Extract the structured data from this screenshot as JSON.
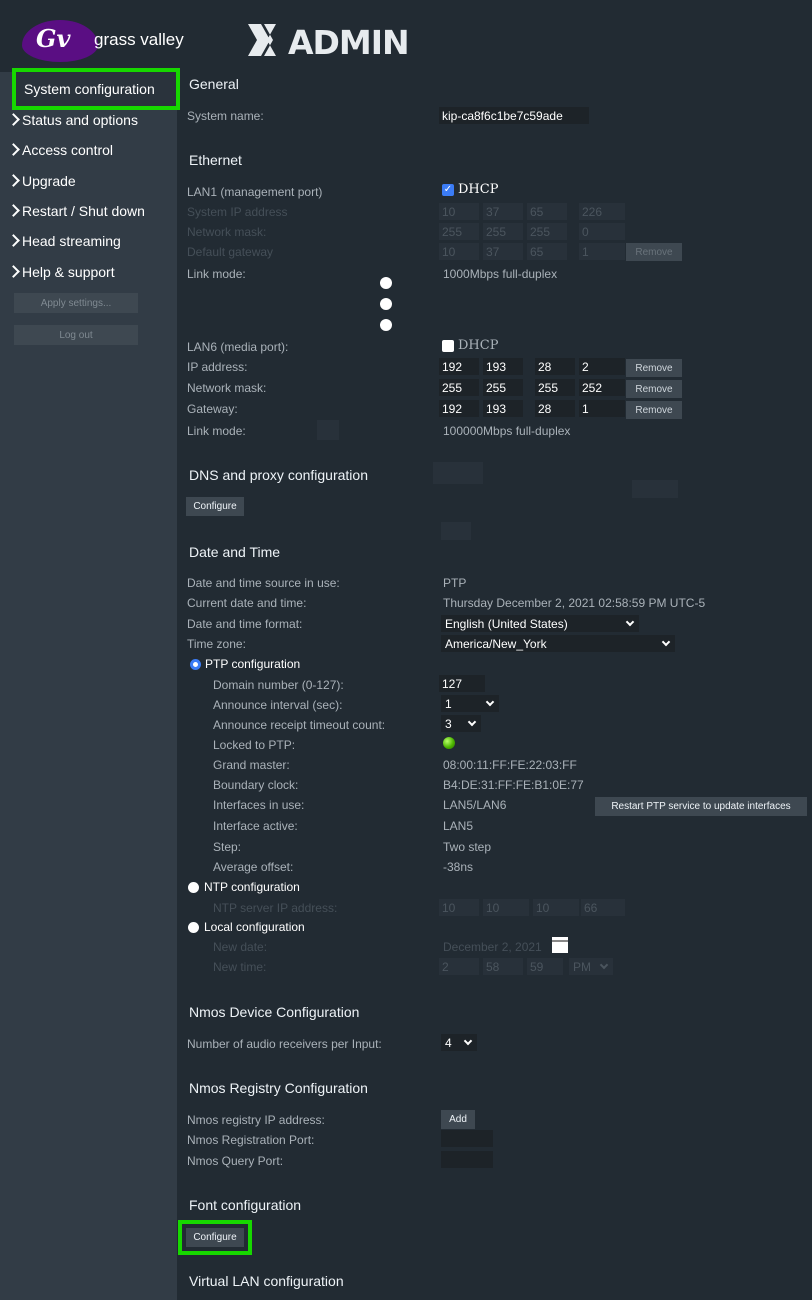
{
  "header": {
    "brand_name": "grass valley",
    "product_name": "ADMIN",
    "product_prefix": "X",
    "emblem": "Gv"
  },
  "sidebar": {
    "items": [
      {
        "label": "System configuration",
        "active": true
      },
      {
        "label": "Status and options"
      },
      {
        "label": "Access control"
      },
      {
        "label": "Upgrade"
      },
      {
        "label": "Restart / Shut down"
      },
      {
        "label": "Head streaming"
      },
      {
        "label": "Help & support"
      }
    ],
    "apply_label": "Apply settings...",
    "logout_label": "Log out"
  },
  "general": {
    "title": "General",
    "system_name_label": "System name:",
    "system_name": "kip-ca8f6c1be7c59ade"
  },
  "ethernet": {
    "title": "Ethernet",
    "lan1_label": "LAN1 (management port)",
    "dhcp_label": "DHCP",
    "system_ip_label": "System IP address",
    "network_mask_label": "Network mask:",
    "default_gateway_label": "Default gateway",
    "link_mode_label": "Link mode:",
    "lan1_ip": [
      "10",
      "37",
      "65",
      "226"
    ],
    "lan1_mask": [
      "255",
      "255",
      "255",
      "0"
    ],
    "lan1_gateway": [
      "10",
      "37",
      "65",
      "1"
    ],
    "lan1_link_mode": "1000Mbps full-duplex",
    "lan6_label": "LAN6 (media port):",
    "ip_label": "IP address:",
    "mask_label": "Network mask:",
    "gateway_label": "Gateway:",
    "lan6_ip": [
      "192",
      "193",
      "28",
      "2"
    ],
    "lan6_mask": [
      "255",
      "255",
      "255",
      "252"
    ],
    "lan6_gateway": [
      "192",
      "193",
      "28",
      "1"
    ],
    "lan6_link_mode": "100000Mbps full-duplex",
    "remove_label": "Remove"
  },
  "dns": {
    "title": "DNS and proxy configuration",
    "configure_label": "Configure"
  },
  "datetime": {
    "title": "Date and Time",
    "source_label": "Date and time source in use:",
    "source_value": "PTP",
    "current_label": "Current date and time:",
    "current_value": "Thursday December 2, 2021 02:58:59 PM UTC-5",
    "format_label": "Date and time format:",
    "format_value": "English (United States)",
    "timezone_label": "Time zone:",
    "timezone_value": "America/New_York",
    "ptp_label": "PTP configuration",
    "domain_label": "Domain number (0-127):",
    "domain_value": "127",
    "announce_label": "Announce interval (sec):",
    "announce_value": "1",
    "receipt_label": "Announce receipt timeout count:",
    "receipt_value": "3",
    "locked_label": "Locked to PTP:",
    "locked_color": "#4cb500",
    "gm_label": "Grand master:",
    "gm_value": "08:00:11:FF:FE:22:03:FF",
    "bc_label": "Boundary clock:",
    "bc_value": "B4:DE:31:FF:FE:B1:0E:77",
    "ifaces_label": "Interfaces in use:",
    "ifaces_value": "LAN5/LAN6",
    "restart_label": "Restart PTP service to update interfaces",
    "active_label": "Interface active:",
    "active_value": "LAN5",
    "step_label": "Step:",
    "step_value": "Two step",
    "offset_label": "Average offset:",
    "offset_value": "-38ns",
    "ntp_label": "NTP configuration",
    "ntp_ip_label": "NTP server IP address:",
    "ntp_ip": [
      "10",
      "10",
      "10",
      "66"
    ],
    "local_label": "Local configuration",
    "new_date_label": "New date:",
    "new_date_value": "December 2, 2021",
    "new_time_label": "New time:",
    "new_time": [
      "2",
      "58",
      "59"
    ],
    "ampm": "PM"
  },
  "nmos_device": {
    "title": "Nmos Device Configuration",
    "receivers_label": "Number of audio receivers per Input:",
    "receivers_value": "4"
  },
  "nmos_registry": {
    "title": "Nmos Registry Configuration",
    "ip_label": "Nmos registry IP address:",
    "add_label": "Add",
    "reg_port_label": "Nmos Registration Port:",
    "query_port_label": "Nmos Query Port:"
  },
  "font": {
    "title": "Font configuration",
    "configure_label": "Configure"
  },
  "vlan": {
    "title": "Virtual LAN configuration"
  },
  "colors": {
    "highlight": "#17d800",
    "sidebar": "#323c46",
    "background": "#222b33",
    "accent": "#3b7cf6"
  }
}
